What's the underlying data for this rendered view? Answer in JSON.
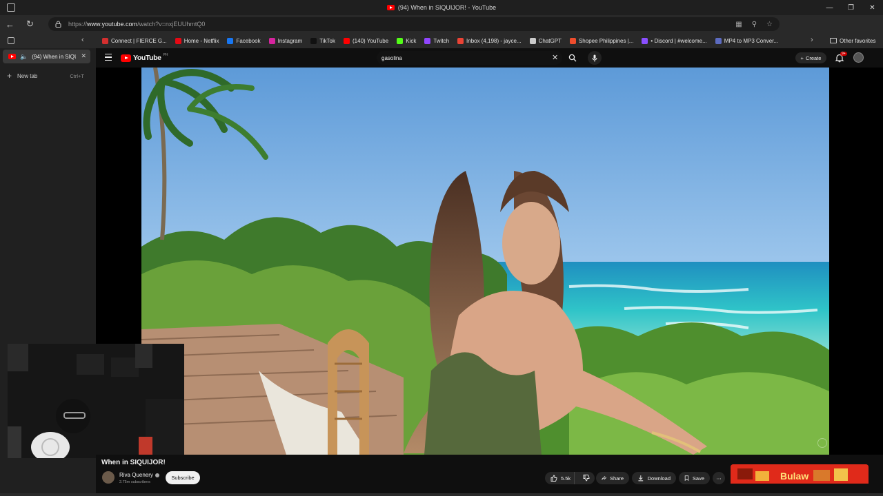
{
  "window": {
    "title": "(94) When in SIQUIJOR! - YouTube"
  },
  "address_bar": {
    "url_prefix": "https://",
    "url_host": "www.youtube.com",
    "url_path": "/watch?v=nxjEUUhmtQ0"
  },
  "favorites": {
    "items": [
      {
        "label": "Connect | FIERCE G...",
        "icon": "red-dot-icon",
        "color": "#d32f2f"
      },
      {
        "label": "Home - Netflix",
        "icon": "netflix-icon",
        "color": "#e50914"
      },
      {
        "label": "Facebook",
        "icon": "facebook-icon",
        "color": "#1877f2"
      },
      {
        "label": "Instagram",
        "icon": "instagram-icon",
        "color": "#d6249f"
      },
      {
        "label": "TikTok",
        "icon": "tiktok-icon",
        "color": "#111111"
      },
      {
        "label": "(140) YouTube",
        "icon": "youtube-icon",
        "color": "#ff0000"
      },
      {
        "label": "Kick",
        "icon": "kick-icon",
        "color": "#53fc18"
      },
      {
        "label": "Twitch",
        "icon": "twitch-icon",
        "color": "#9146ff"
      },
      {
        "label": "Inbox (4,198) - jayce...",
        "icon": "gmail-icon",
        "color": "#ea4335"
      },
      {
        "label": "ChatGPT",
        "icon": "chatgpt-icon",
        "color": "#cccccc"
      },
      {
        "label": "Shopee Philippines |...",
        "icon": "shopee-icon",
        "color": "#ee4d2d"
      },
      {
        "label": "• Discord | #welcome...",
        "icon": "discord-icon",
        "color": "#8a4fff"
      },
      {
        "label": "MP4 to MP3 Conver...",
        "icon": "converter-icon",
        "color": "#5c6bc0"
      }
    ],
    "other_label": "Other favorites"
  },
  "sidebar": {
    "active_tab_title": "(94) When in SIQUIJOR! - YouTube",
    "new_tab_label": "New tab",
    "new_tab_shortcut": "Ctrl+T"
  },
  "youtube": {
    "logo_text": "YouTube",
    "country_code": "PH",
    "search_value": "gasolina",
    "create_label": "Create",
    "notification_count": "9+",
    "video_title": "When in SIQUIJOR!",
    "channel_name": "Riva Quenery",
    "subscriber_text": "2.75m subscribers",
    "subscribe_label": "Subscribe",
    "like_count": "5.5k",
    "share_label": "Share",
    "download_label": "Download",
    "save_label": "Save",
    "ad_brand": "Bulaw"
  },
  "colors": {
    "youtube_red": "#ff0000",
    "background": "#0f0f0f",
    "chip": "#272727"
  }
}
